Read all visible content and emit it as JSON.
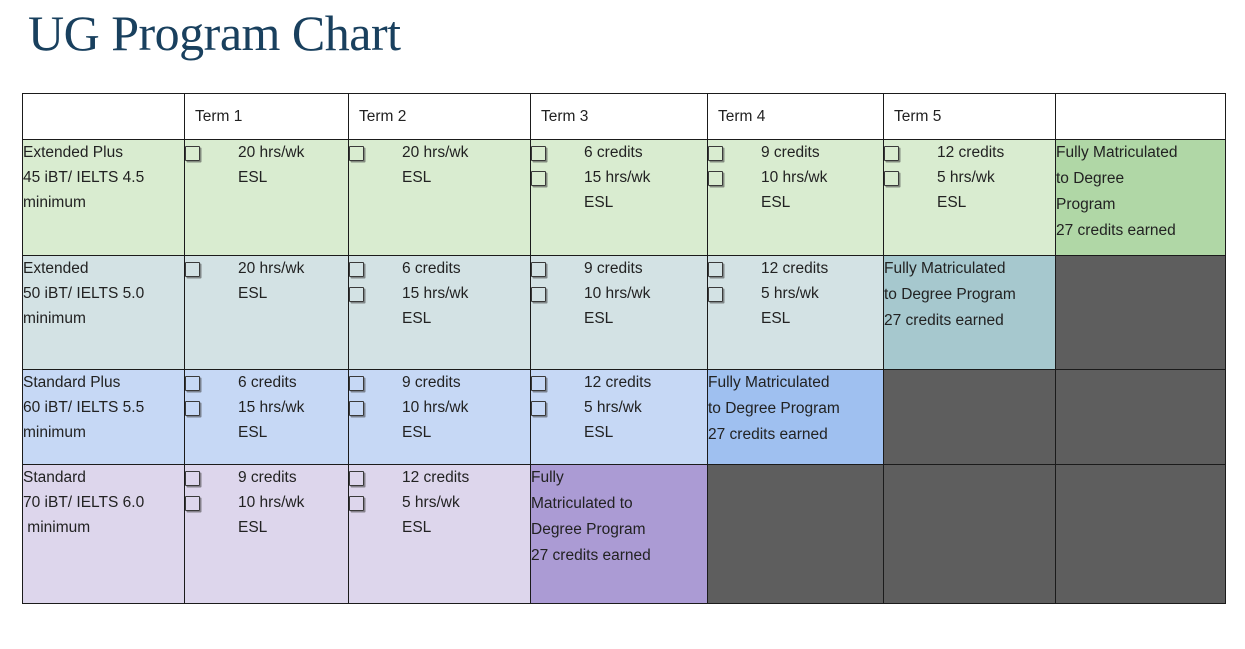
{
  "title": "UG Program Chart",
  "table": {
    "headers": [
      "",
      "Term 1",
      "Term 2",
      "Term 3",
      "Term 4",
      "Term 5",
      ""
    ],
    "colors": {
      "row1_light": "#d9ecd0",
      "row1_dark": "#b0d7a6",
      "row2_light": "#d3e2e4",
      "row2_dark": "#a6c8ce",
      "row3_light": "#c6d8f5",
      "row3_dark": "#9fc0f0",
      "row4_light": "#ddd6ec",
      "row4_dark": "#ab9bd4",
      "disabled": "#5e5e5e",
      "border": "#1b1b1b",
      "title": "#19405e"
    },
    "rows": [
      {
        "program": {
          "name": "Extended Plus",
          "requirement": "45 iBT/ IELTS 4.5",
          "note": "minimum"
        },
        "terms": [
          {
            "type": "tasks",
            "items": [
              "20 hrs/wk\nESL"
            ]
          },
          {
            "type": "tasks",
            "items": [
              "20 hrs/wk\nESL"
            ]
          },
          {
            "type": "tasks",
            "items": [
              "6 credits",
              "15 hrs/wk\nESL"
            ]
          },
          {
            "type": "tasks",
            "items": [
              "9 credits",
              "10 hrs/wk\nESL"
            ]
          },
          {
            "type": "tasks",
            "items": [
              "12 credits",
              "5 hrs/wk\nESL"
            ]
          }
        ],
        "final": {
          "type": "matriculated",
          "lines": [
            "Fully Matriculated",
            "to Degree",
            "Program",
            "27 credits earned"
          ]
        }
      },
      {
        "program": {
          "name": "Extended",
          "requirement": "50 iBT/ IELTS 5.0",
          "note": "minimum"
        },
        "terms": [
          {
            "type": "tasks",
            "items": [
              "20 hrs/wk\nESL"
            ]
          },
          {
            "type": "tasks",
            "items": [
              "6 credits",
              "15 hrs/wk\nESL"
            ]
          },
          {
            "type": "tasks",
            "items": [
              "9 credits",
              "10 hrs/wk\nESL"
            ]
          },
          {
            "type": "tasks",
            "items": [
              "12 credits",
              "5 hrs/wk\nESL"
            ]
          },
          {
            "type": "matriculated",
            "lines": [
              "Fully Matriculated",
              "to Degree Program",
              "27 credits earned"
            ]
          }
        ],
        "final": {
          "type": "disabled",
          "lines": []
        }
      },
      {
        "program": {
          "name": "Standard Plus",
          "requirement": "60 iBT/ IELTS 5.5",
          "note": "minimum"
        },
        "terms": [
          {
            "type": "tasks",
            "items": [
              "6 credits",
              "15 hrs/wk\nESL"
            ]
          },
          {
            "type": "tasks",
            "items": [
              "9 credits",
              "10 hrs/wk\nESL"
            ]
          },
          {
            "type": "tasks",
            "items": [
              "12 credits",
              "5 hrs/wk\nESL"
            ]
          },
          {
            "type": "matriculated",
            "lines": [
              "Fully Matriculated",
              "to Degree Program",
              "27 credits earned"
            ]
          },
          {
            "type": "disabled",
            "lines": []
          }
        ],
        "final": {
          "type": "disabled",
          "lines": []
        }
      },
      {
        "program": {
          "name": "Standard",
          "requirement": "70 iBT/ IELTS 6.0",
          "note": " minimum"
        },
        "terms": [
          {
            "type": "tasks",
            "items": [
              "9 credits",
              "10 hrs/wk\nESL"
            ]
          },
          {
            "type": "tasks",
            "items": [
              "12 credits",
              "5 hrs/wk\nESL"
            ]
          },
          {
            "type": "matriculated",
            "lines": [
              "Fully",
              "Matriculated to",
              "Degree Program",
              "27 credits earned"
            ]
          },
          {
            "type": "disabled",
            "lines": []
          },
          {
            "type": "disabled",
            "lines": []
          }
        ],
        "final": {
          "type": "disabled",
          "lines": []
        }
      }
    ]
  },
  "icons": {
    "checkbox": "checkbox-icon"
  }
}
